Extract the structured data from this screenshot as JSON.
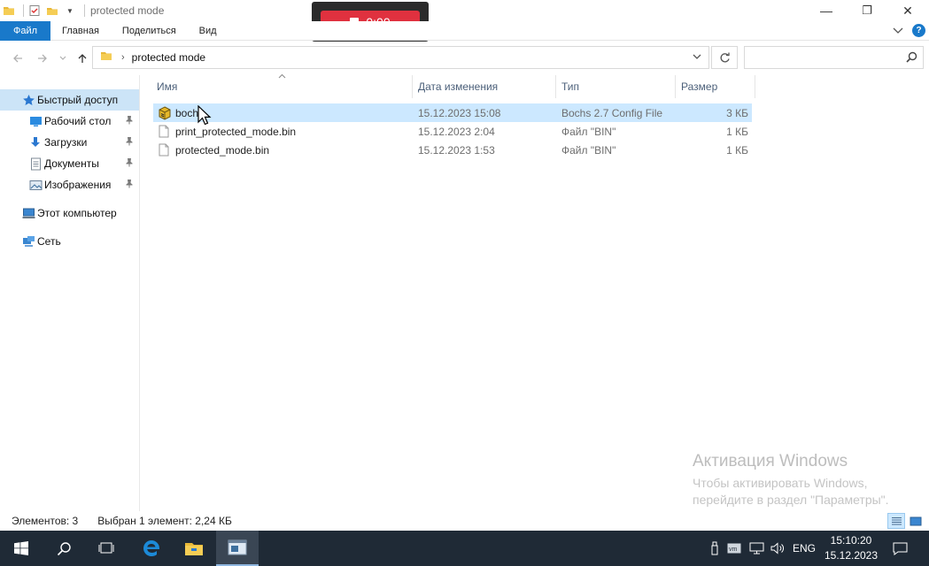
{
  "window": {
    "title": "protected mode",
    "minimize_glyph": "—",
    "restore_glyph": "❐",
    "close_glyph": "✕"
  },
  "recorder": {
    "time": "0:00"
  },
  "ribbon": {
    "tabs": [
      "Файл",
      "Главная",
      "Поделиться",
      "Вид"
    ]
  },
  "address": {
    "path": "protected mode",
    "search_placeholder": ""
  },
  "sidebar": {
    "quick_access": "Быстрый доступ",
    "items": [
      {
        "label": "Рабочий стол"
      },
      {
        "label": "Загрузки"
      },
      {
        "label": "Документы"
      },
      {
        "label": "Изображения"
      }
    ],
    "this_pc": "Этот компьютер",
    "network": "Сеть"
  },
  "columns": {
    "name": "Имя",
    "date": "Дата изменения",
    "type": "Тип",
    "size": "Размер"
  },
  "files": [
    {
      "name": "bochs",
      "date": "15.12.2023 15:08",
      "type": "Bochs 2.7 Config File",
      "size": "3 КБ",
      "selected": true
    },
    {
      "name": "print_protected_mode.bin",
      "date": "15.12.2023 2:04",
      "type": "Файл \"BIN\"",
      "size": "1 КБ",
      "selected": false
    },
    {
      "name": "protected_mode.bin",
      "date": "15.12.2023 1:53",
      "type": "Файл \"BIN\"",
      "size": "1 КБ",
      "selected": false
    }
  ],
  "watermark": {
    "title": "Активация Windows",
    "line1": "Чтобы активировать Windows,",
    "line2": "перейдите в раздел \"Параметры\"."
  },
  "status": {
    "count": "Элементов: 3",
    "selection": "Выбран 1 элемент: 2,24 КБ"
  },
  "taskbar": {
    "lang": "ENG",
    "time": "15:10:20",
    "date": "15.12.2023"
  },
  "colors": {
    "accent": "#1979ca",
    "selection": "#cce8ff",
    "taskbar": "#1f2a36",
    "record": "#e0313f"
  }
}
